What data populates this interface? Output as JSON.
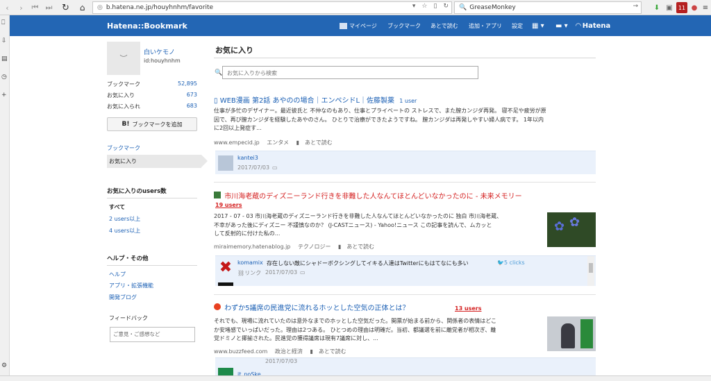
{
  "browser": {
    "url": "b.hatena.ne.jp/houyhnhm/favorite",
    "search_engine": "GreaseMonkey",
    "badge_count": "11"
  },
  "header": {
    "logo": "Hatena::Bookmark",
    "menu": [
      "マイページ",
      "ブックマーク",
      "あとで読む",
      "追加・アプリ",
      "設定"
    ],
    "hatena": "Hatena"
  },
  "profile": {
    "name": "白いケモノ",
    "id": "id:houyhnhm",
    "stats": [
      {
        "label": "ブックマーク",
        "value": "52,895"
      },
      {
        "label": "お気に入り",
        "value": "673"
      },
      {
        "label": "お気に入られ",
        "value": "683"
      }
    ],
    "add_button": "ブックマークを追加",
    "add_button_badge": "B!"
  },
  "leftnav": {
    "bookmark": "ブックマーク",
    "favorite": "お気に入り",
    "users_heading": "お気に入りのusers数",
    "users_all": "すべて",
    "users_2": "2 users以上",
    "users_4": "4 users以上",
    "help_heading": "ヘルプ・その他",
    "help": "ヘルプ",
    "apps": "アプリ・拡張機能",
    "blog": "開発ブログ",
    "feedback_label": "フィードバック",
    "feedback_placeholder": "ご意見・ご感想など"
  },
  "main": {
    "title": "お気に入り",
    "search_placeholder": "お気に入りから検索",
    "entries": [
      {
        "title": "WEB漫画 第2話 あやのの場合｜エンペシドL｜佐藤製薬",
        "users": "1 user",
        "body": [
          "仕事が多忙のデザイナー。最近彼氏と 不仲なのもあり、仕事とプライベートの ストレスで、また膣カンジダ再発。 寝不足や疲労が原",
          "因で、再び膣カンジダを経験したあやのさん。 ひとりで治療ができたようですね。 膣カンジダは再発しやすい婦人病です。 1年以内",
          "に2回以上発症す..."
        ],
        "domain": "www.empecid.jp",
        "category": "エンタメ",
        "later": "あとで読む",
        "comment": {
          "user": "kantei3",
          "date": "2017/07/03"
        }
      },
      {
        "title": "市川海老蔵のディズニーランド行きを非難した人なんてほとんどいなかったのに - 未来メモリー",
        "users": "19 users",
        "body": [
          "2017 - 07 - 03 市川海老蔵のディズニーランド行きを非難した人なんてほとんどいなかったのに 独白 市川海老蔵、",
          "不幸があった後にディズニー 不謹慎なのか？ (J-CASTニュース) - Yahoo!ニュース この記事を読んで、ムカッと",
          "して反射的に付けた私の..."
        ],
        "domain": "miraimemory.hatenablog.jp",
        "category": "テクノロジー",
        "later": "あとで読む",
        "comment": {
          "user": "komamix",
          "text": "存在しない敵にシャドーボクシングしてイキる人達はTwitterにもはてなにも多い",
          "clicks": "5 clicks",
          "link": "リンク",
          "date": "2017/07/03"
        }
      },
      {
        "title": "わずか5議席の民進党に流れるホッとした空気の正体とは？",
        "users": "13 users",
        "body": [
          "それでも、現場に流れていたのは意外なまでのホッとした空気だった。開票が始まる前から、関係者の表情はどこ",
          "か安堵感でいっぱいだった。理由は2つある。 ひとつめの理由は明確だ。当初、都議選を前に離党者が相次ぎ、離",
          "党ドミノと揶揄された。民進党の獲得議席は現有7議席に対し、..."
        ],
        "domain": "www.buzzfeed.com",
        "category": "政治と経済",
        "later": "あとで読む",
        "comment": {
          "user": "it_noSke",
          "date": "2017/07/03"
        }
      }
    ]
  }
}
